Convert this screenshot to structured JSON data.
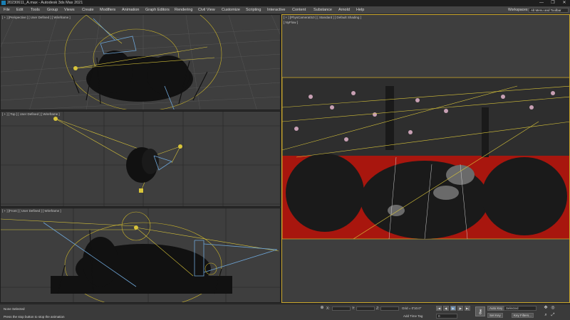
{
  "window": {
    "title": "20230611_A.max - Autodesk 3ds Max 2021",
    "buttons": [
      "—",
      "❐",
      "✕"
    ]
  },
  "menu": {
    "items": [
      "File",
      "Edit",
      "Tools",
      "Group",
      "Views",
      "Create",
      "Modifiers",
      "Animation",
      "Graph Editors",
      "Rendering",
      "Civil View",
      "Customize",
      "Scripting",
      "Interactive",
      "Content",
      "Substance",
      "Arnold",
      "Help"
    ],
    "workspaces_label": "Workspaces:",
    "workspace_value": "Alt Menu and Toolbar"
  },
  "viewports": {
    "perspective": {
      "label": "[ + ] [Perspective ] [ User Defined ] [ Wireframe ]"
    },
    "top": {
      "label": "[ + ] [ Top ] [ User Defined ] [ Wireframe ]"
    },
    "front": {
      "label": "[ + ] [Front ] [ User Defined ] [ Wireframe ]"
    },
    "camera": {
      "label": "[ + ] [PhysCamera010 ] [ Standard ] [ Default Shading ]",
      "sublabel": "[ NyFlow ]"
    }
  },
  "status": {
    "selection": "None Selected",
    "prompt": "Press the stop button to stop the animation",
    "x_label": "X:",
    "y_label": "Y:",
    "z_label": "Z:",
    "grid": "Grid = 0'10.0\"",
    "add_time_tag": "Add Time Tag",
    "frame": "0",
    "auto_key": "Auto Key",
    "set_key": "Set Key",
    "selected_value": "Selected",
    "key_filters": "Key Filters...",
    "playback": [
      "|◀",
      "◀|",
      "▶",
      "|▶",
      "▶|"
    ],
    "nav_icons": [
      "✥",
      "◎",
      "⌕",
      "⤢"
    ]
  },
  "colors": {
    "viewport_bg": "#3e3e3e",
    "active_border": "#c8a52a",
    "light_yellow": "#d8c43a",
    "camera_blue": "#6ea6d8",
    "render_red": "#a8160e"
  }
}
